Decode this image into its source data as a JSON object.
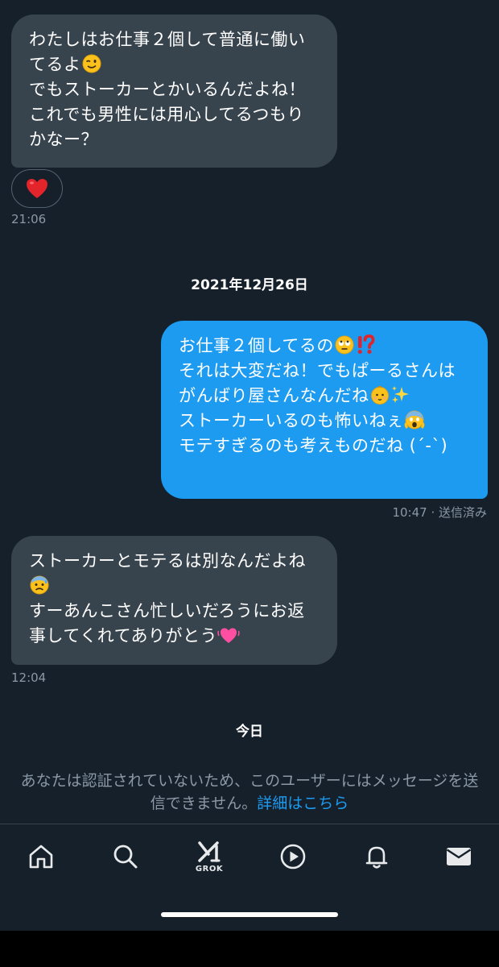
{
  "messages": [
    {
      "text": "わたしはお仕事２個して普通に働いてるよ",
      "emoji1": "winking-face",
      "text2": "\nでもストーカーとかいるんだよね！これでも男性には用心してるつもりかなー？",
      "reaction": "red-heart",
      "time": "21:06"
    },
    {
      "line1": "お仕事２個してるの",
      "line2": "それは大変だね！でもぱーるさんはがんばり屋さんなんだね",
      "line3": "ストーカーいるのも怖いねぇ",
      "line4": "モテすぎるのも考えものだね (´-`)",
      "time": "10:47 · 送信済み"
    },
    {
      "line1": "ストーカーとモテるは別なんだよね",
      "line2": "すーあんこさん忙しいだろうにお返事してくれてありがとう",
      "time": "12:04"
    }
  ],
  "date_separators": [
    "2021年12月26日",
    "今日"
  ],
  "notice": {
    "text": "あなたは認証されていないため、このユーザーにはメッセージを送信できません。",
    "link": "詳細はこちら"
  },
  "nav": {
    "grok_label": "GROK",
    "items": [
      "home-icon",
      "search-icon",
      "grok-icon",
      "video-icon",
      "notifications-icon",
      "messages-icon"
    ]
  },
  "colors": {
    "background": "#15202b",
    "incoming_bubble": "#38444d",
    "outgoing_bubble": "#1d9bf0",
    "meta_text": "#8b98a5",
    "link": "#1d9bf0"
  }
}
